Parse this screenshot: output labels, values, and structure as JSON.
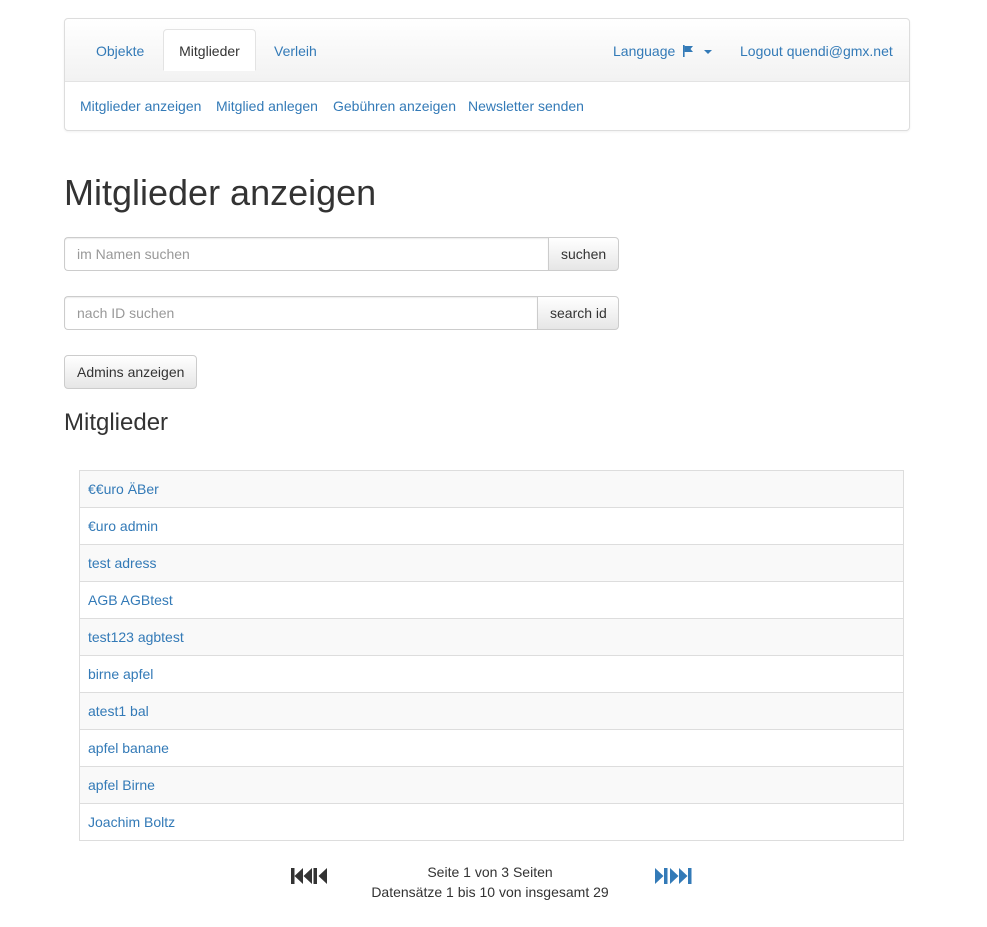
{
  "nav": {
    "tabs": [
      {
        "label": "Objekte"
      },
      {
        "label": "Mitglieder"
      },
      {
        "label": "Verleih"
      }
    ],
    "language_label": "Language",
    "logout_label": "Logout quendi@gmx.net"
  },
  "subnav": {
    "items": [
      {
        "label": "Mitglieder anzeigen"
      },
      {
        "label": "Mitglied anlegen"
      },
      {
        "label": "Gebühren anzeigen"
      },
      {
        "label": "Newsletter senden"
      }
    ]
  },
  "main": {
    "title": "Mitglieder anzeigen",
    "name_search": {
      "placeholder": "im Namen suchen",
      "button": "suchen"
    },
    "id_search": {
      "placeholder": "nach ID suchen",
      "button": "search id"
    },
    "admins_button": "Admins anzeigen",
    "section_title": "Mitglieder"
  },
  "members": [
    "€€uro ÄBer",
    "€uro admin",
    "test adress",
    "AGB AGBtest",
    "test123 agbtest",
    "birne apfel",
    "atest1 bal",
    "apfel banane",
    "apfel Birne",
    "Joachim Boltz"
  ],
  "pagination": {
    "page_info": "Seite 1 von 3 Seiten",
    "records_info": "Datensätze 1 bis 10 von insgesamt 29"
  },
  "colors": {
    "link": "#337ab7",
    "pager_first": "#333333",
    "pager_last": "#337ab7"
  },
  "icons": {
    "first_page": "first-page-icon",
    "last_page": "last-page-icon",
    "language": "flag-icon"
  }
}
